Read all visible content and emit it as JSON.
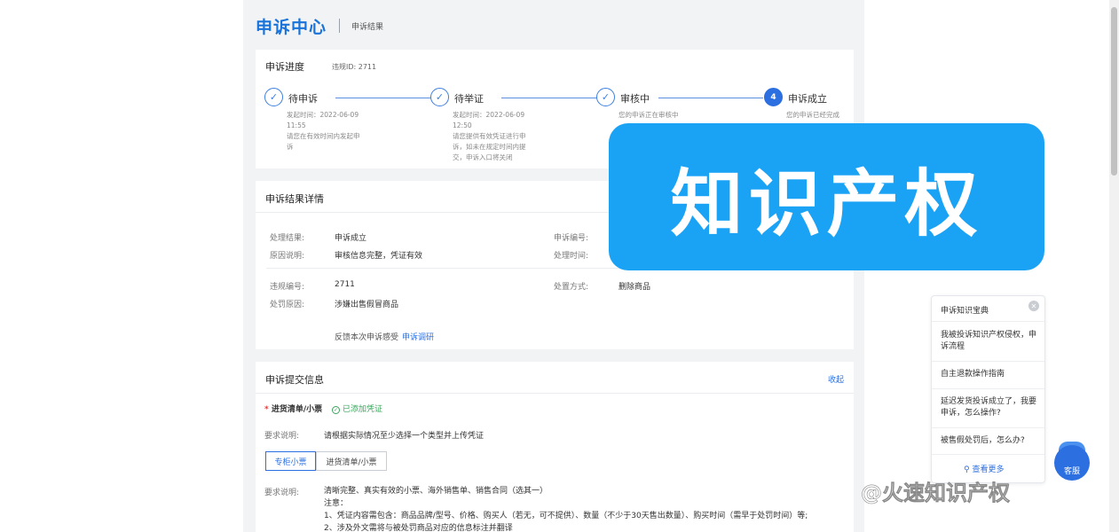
{
  "header": {
    "brand": "申诉中心",
    "subtitle": "申诉结果"
  },
  "progress": {
    "title": "申诉进度",
    "violation_id": "违规ID: 2711",
    "steps": [
      {
        "name": "待申诉",
        "icon": "✓",
        "lines": [
          "发起时间：2022-06-09",
          "11:55",
          "请您在有效时间内发起申",
          "诉"
        ]
      },
      {
        "name": "待举证",
        "icon": "✓",
        "lines": [
          "发起时间：2022-06-09",
          "12:50",
          "请您提供有效凭证进行申",
          "诉，如未在规定时间内提",
          "交，申诉入口将关闭"
        ]
      },
      {
        "name": "审核中",
        "icon": "✓",
        "lines": [
          "您的申诉正在审核中"
        ]
      },
      {
        "name": "申诉成立",
        "icon": "4",
        "lines": [
          "您的申诉已经完成"
        ]
      }
    ]
  },
  "result": {
    "title": "申诉结果详情",
    "rows_left": [
      {
        "label": "处理结果:",
        "value": "申诉成立"
      },
      {
        "label": "原因说明:",
        "value": "审核信息完整，凭证有效"
      },
      {
        "label": "违规编号:",
        "value": "2711"
      },
      {
        "label": "处罚原因:",
        "value": "涉嫌出售假冒商品"
      }
    ],
    "rows_right": [
      {
        "label": "申诉编号:",
        "value": ""
      },
      {
        "label": "处理时间:",
        "value": ""
      },
      {
        "label": "处置方式:",
        "value": "删除商品"
      }
    ],
    "feedback_text": "反馈本次申诉感受",
    "feedback_link": "申诉调研"
  },
  "submit": {
    "title": "申诉提交信息",
    "collapse": "收起",
    "field_label": "进货清单/小票",
    "added_status": "已添加凭证",
    "req_label": "要求说明:",
    "req_text": "请根据实际情况至少选择一个类型并上传凭证",
    "tabs": [
      "专柜小票",
      "进货清单/小票"
    ],
    "req_label2": "要求说明:",
    "detail_lines": [
      "清晰完整、真实有效的小票、海外销售单、销售合同（选其一）",
      "注意：",
      "1、凭证内容需包含：商品品牌/型号、价格、购买人（若无，可不提供）、数量（不少于30天售出数量）、购买时间（需早于处罚时间）等;",
      "2、涉及外文需将与被处罚商品对应的信息标注并翻译"
    ]
  },
  "banner": {
    "text": "知识产权"
  },
  "kb": {
    "title": "申诉知识宝典",
    "items": [
      "我被投诉知识产权侵权，申诉流程",
      "自主退款操作指南",
      "延迟发货投诉成立了，我要申诉，怎么操作?",
      "被售假处罚后，怎么办?"
    ],
    "more": "查看更多"
  },
  "chat": {
    "label": "客服"
  },
  "watermark": "@火速知识产权"
}
